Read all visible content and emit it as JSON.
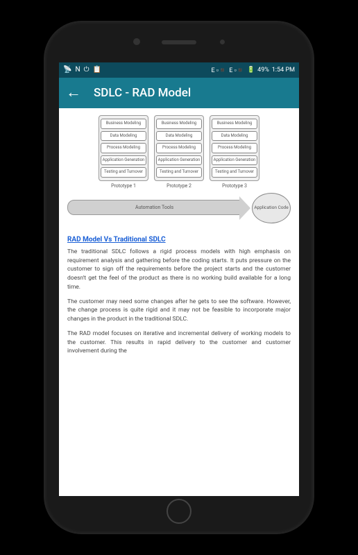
{
  "status_bar": {
    "left_icons": [
      "📡",
      "N",
      "⏻",
      "📋"
    ],
    "right": {
      "signal1": "E ▫◾",
      "signal2": "E ▫◾",
      "battery_icon": "🔋",
      "battery_pct": "49%",
      "time": "1:54 PM"
    }
  },
  "app_bar": {
    "back": "←",
    "title": "SDLC - RAD Model"
  },
  "diagram": {
    "stages": [
      "Business Modeling",
      "Data Modeling",
      "Process Modeling",
      "Application Generation",
      "Testing and Turnover"
    ],
    "prototypes": [
      "Prototype 1",
      "Prototype 2",
      "Prototype 3"
    ],
    "flow_label": "Automation Tools",
    "output": "Application Code"
  },
  "section": {
    "title": "RAD Model Vs Traditional SDLC",
    "p1": "The traditional SDLC follows a rigid process models with high emphasis on requirement analysis and gathering before the coding starts. It puts pressure on the customer to sign off the requirements before the project starts and the customer doesn't get the feel of the product as there is no working build available for a long time.",
    "p2": "The customer may need some changes after he gets to see the software. However, the change process is quite rigid and it may not be feasible to incorporate major changes in the product in the traditional SDLC.",
    "p3": "The RAD model focuses on iterative and incremental delivery of working models to the customer. This results in rapid delivery to the customer and customer involvement during the"
  }
}
